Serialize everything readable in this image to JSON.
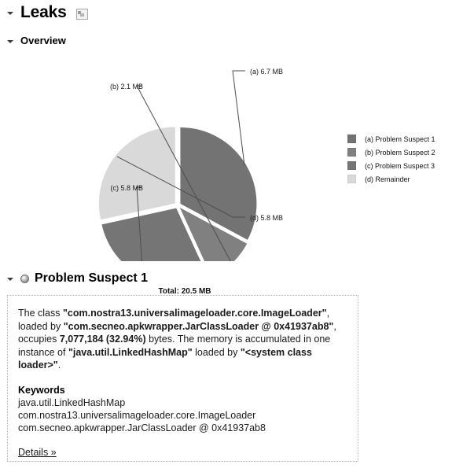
{
  "leaks": {
    "title": "Leaks",
    "icon": "export-image-icon"
  },
  "overview": {
    "title": "Overview",
    "total_label": "Total: 20.5 MB"
  },
  "chart_data": {
    "type": "pie",
    "title": "Overview",
    "total": "Total: 20.5 MB",
    "labels": [
      "(a)  6.7 MB",
      "(b)  2.1 MB",
      "(c)  5.8 MB",
      "(d)  5.8 MB"
    ],
    "categories": [
      "(a) Problem Suspect 1",
      "(b) Problem Suspect 2",
      "(c) Problem Suspect 3",
      "(d) Remainder"
    ],
    "values": [
      6.7,
      2.1,
      5.8,
      5.8
    ],
    "unit": "MB",
    "percents": [
      32.94,
      10.24,
      28.41,
      28.41
    ],
    "colors": [
      "#737373",
      "#808080",
      "#757575",
      "#d9d9d9"
    ],
    "legend_position": "right",
    "grid": false
  },
  "legend": {
    "items": [
      {
        "label": "(a) Problem Suspect 1",
        "color": "#737373"
      },
      {
        "label": "(b) Problem Suspect 2",
        "color": "#808080"
      },
      {
        "label": "(c) Problem Suspect 3",
        "color": "#757575"
      },
      {
        "label": "(d) Remainder",
        "color": "#d9d9d9"
      }
    ]
  },
  "suspect": {
    "title": "Problem Suspect 1",
    "icon": "sphere-bullet-icon",
    "description": {
      "p1": "The class ",
      "class_name": "\"com.nostra13.universalimageloader.core.ImageLoader\"",
      "p2": ", loaded by ",
      "loader_name": "\"com.secneo.apkwrapper.JarClassLoader @ 0x41937ab8\"",
      "p3": ", occupies ",
      "bytes": "7,077,184 (32.94%)",
      "p4": " bytes. The memory is accumulated in one instance of ",
      "instance_class": "\"java.util.LinkedHashMap\"",
      "p5": " loaded by ",
      "system_loader": "\"<system class loader>\"",
      "p6": "."
    },
    "keywords_heading": "Keywords",
    "keywords": [
      "java.util.LinkedHashMap",
      "com.nostra13.universalimageloader.core.ImageLoader",
      "com.secneo.apkwrapper.JarClassLoader @ 0x41937ab8"
    ],
    "details_link": "Details »"
  }
}
